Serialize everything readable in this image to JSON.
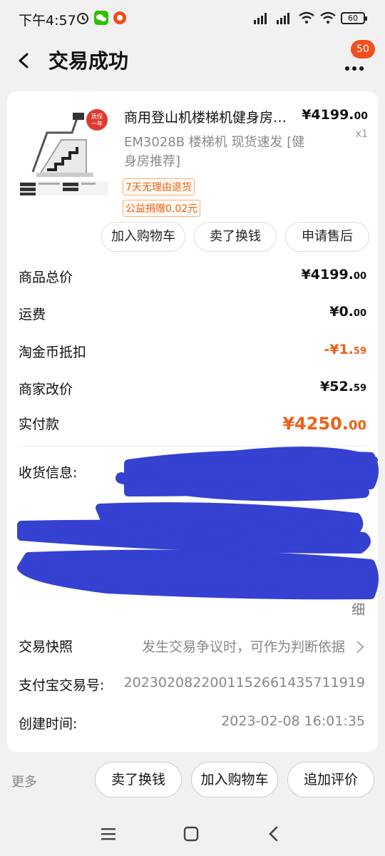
{
  "status": {
    "time": "下午4:57",
    "battery": "60"
  },
  "header": {
    "title": "交易成功",
    "badge": "50"
  },
  "product": {
    "name": "商用登山机楼梯机健身房…",
    "spec": "EM3028B 楼梯机  现货速发 [健身房推荐]",
    "price_main": "¥4199.",
    "price_dec": "00",
    "qty": "x1",
    "tag1": "7天无理由退货",
    "tag2": "公益捐赠0.02元",
    "thumb_badge": "质保一年"
  },
  "actions": {
    "add_cart": "加入购物车",
    "sell": "卖了换钱",
    "after_sale": "申请售后"
  },
  "summary": {
    "total_label": "商品总价",
    "total_main": "¥4199.",
    "total_dec": "00",
    "shipping_label": "运费",
    "shipping_main": "¥0.",
    "shipping_dec": "00",
    "coin_label": "淘金币抵扣",
    "coin_main": "-¥1.",
    "coin_dec": "59",
    "adjust_label": "商家改价",
    "adjust_main": "¥52.",
    "adjust_dec": "59",
    "paid_label": "实付款",
    "paid_main": "¥4250.",
    "paid_dec": "00"
  },
  "info": {
    "address_label": "收货信息:",
    "address_tail": "细",
    "snapshot_label": "交易快照",
    "snapshot_value": "发生交易争议时，可作为判断依据",
    "alipay_label": "支付宝交易号:",
    "alipay_value": "2023020822001152661435711919",
    "created_label": "创建时间:",
    "created_value": "2023-02-08 16:01:35"
  },
  "bottom": {
    "more": "更多",
    "sell": "卖了换钱",
    "add_cart": "加入购物车",
    "review": "追加评价"
  },
  "colors": {
    "accent": "#f06016",
    "scribble": "#2f3bd0"
  }
}
